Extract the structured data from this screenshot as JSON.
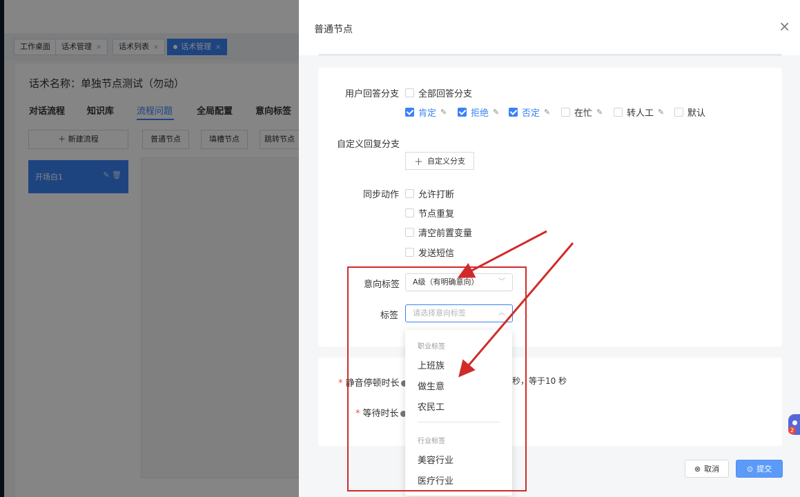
{
  "background": {
    "tabs": [
      {
        "label": "工作桌面",
        "closable": false
      },
      {
        "label": "话术管理",
        "closable": true
      },
      {
        "label": "话术列表",
        "closable": true
      },
      {
        "label": "话术管理",
        "closable": true,
        "active": true
      }
    ],
    "script_title": "话术名称：单独节点测试（勿动）",
    "nav": [
      "对话流程",
      "知识库",
      "流程问题",
      "全局配置",
      "意向标签"
    ],
    "nav_active": "流程问题",
    "new_flow_button": "新建流程",
    "node_buttons": [
      "普通节点",
      "填槽节点",
      "跳转节点"
    ],
    "flow_items": [
      {
        "label": "开场白1"
      }
    ]
  },
  "drawer": {
    "title": "普通节点",
    "user_reply_branch": {
      "label": "用户回答分支",
      "all_option": "全部回答分支",
      "options": [
        {
          "label": "肯定",
          "checked": true,
          "editable": true
        },
        {
          "label": "拒绝",
          "checked": true,
          "editable": true
        },
        {
          "label": "否定",
          "checked": true,
          "editable": true
        },
        {
          "label": "在忙",
          "checked": false,
          "editable": true
        },
        {
          "label": "转人工",
          "checked": false,
          "editable": true
        },
        {
          "label": "默认",
          "checked": false,
          "editable": false
        }
      ]
    },
    "custom_reply_branch": {
      "label": "自定义回复分支",
      "button": "自定义分支"
    },
    "sync_action": {
      "label": "同步动作",
      "options": [
        "允许打断",
        "节点重复",
        "清空前置变量",
        "发送短信"
      ]
    },
    "intent_tag": {
      "label": "意向标签",
      "value": "A级（有明确意向）"
    },
    "tag": {
      "label": "标签",
      "placeholder": "请选择意向标签",
      "dropdown": {
        "groups": [
          {
            "name": "职业标签",
            "items": [
              "上班族",
              "做生意",
              "农民工"
            ]
          },
          {
            "name": "行业标签",
            "items": [
              "美容行业",
              "医疗行业"
            ]
          }
        ]
      }
    },
    "silence_pause": {
      "label": "静音停顿时长",
      "suffix": "秒，等于10 秒"
    },
    "wait_time": {
      "label": "等待时长"
    },
    "cancel_button": "取消",
    "submit_button": "提交"
  },
  "floating_assistant": {
    "badge": "2"
  },
  "colors": {
    "accent": "#3b82f6",
    "annotation_red": "#d12a2a",
    "required": "#e74c3c"
  }
}
